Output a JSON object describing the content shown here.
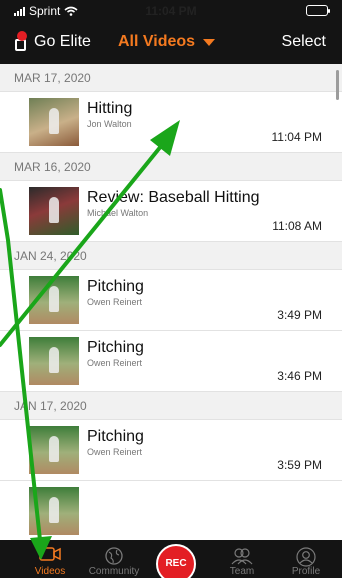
{
  "status_bar": {
    "carrier": "Sprint",
    "time": "11:04 PM"
  },
  "nav": {
    "go_elite": "Go Elite",
    "title": "All Videos",
    "select": "Select"
  },
  "sections": [
    {
      "date": "MAR 17, 2020",
      "videos": [
        {
          "title": "Hitting",
          "author": "Jon Walton",
          "time": "11:04 PM"
        }
      ]
    },
    {
      "date": "MAR 16, 2020",
      "videos": [
        {
          "title": "Review: Baseball Hitting",
          "author": "Michael Walton",
          "time": "11:08 AM"
        }
      ]
    },
    {
      "date": "JAN 24, 2020",
      "videos": [
        {
          "title": "Pitching",
          "author": "Owen Reinert",
          "time": "3:49 PM"
        },
        {
          "title": "Pitching",
          "author": "Owen Reinert",
          "time": "3:46 PM"
        }
      ]
    },
    {
      "date": "JAN 17, 2020",
      "videos": [
        {
          "title": "Pitching",
          "author": "Owen Reinert",
          "time": "3:59 PM"
        }
      ]
    }
  ],
  "tab_bar": {
    "videos": "Videos",
    "community": "Community",
    "rec": "REC",
    "team": "Team",
    "profile": "Profile"
  },
  "colors": {
    "accent": "#f47a20",
    "rec": "#e31e24",
    "annotation_arrow": "#1aa61a",
    "bar": "#141414"
  }
}
